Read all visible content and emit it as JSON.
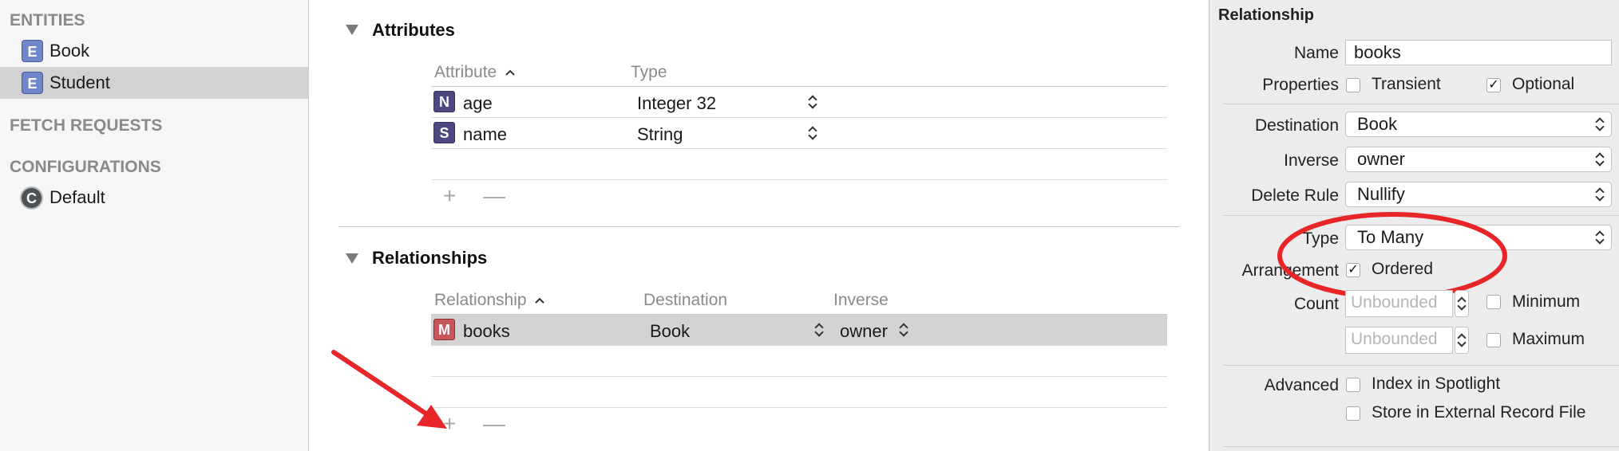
{
  "sidebar": {
    "entities_header": "ENTITIES",
    "entities": [
      {
        "badge": "E",
        "label": "Book",
        "selected": false
      },
      {
        "badge": "E",
        "label": "Student",
        "selected": true
      }
    ],
    "fetch_requests_header": "FETCH REQUESTS",
    "configurations_header": "CONFIGURATIONS",
    "configurations": [
      {
        "badge": "C",
        "label": "Default"
      }
    ]
  },
  "attributes": {
    "title": "Attributes",
    "columns": [
      "Attribute",
      "Type"
    ],
    "rows": [
      {
        "badge": "N",
        "name": "age",
        "type": "Integer 32"
      },
      {
        "badge": "S",
        "name": "name",
        "type": "String"
      }
    ],
    "add_label": "+",
    "remove_label": "—"
  },
  "relationships": {
    "title": "Relationships",
    "columns": [
      "Relationship",
      "Destination",
      "Inverse"
    ],
    "rows": [
      {
        "badge": "M",
        "name": "books",
        "destination": "Book",
        "inverse": "owner",
        "selected": true
      }
    ],
    "add_label": "+",
    "remove_label": "—"
  },
  "inspector": {
    "title": "Relationship",
    "name_label": "Name",
    "name_value": "books",
    "properties_label": "Properties",
    "transient_label": "Transient",
    "transient_checked": false,
    "optional_label": "Optional",
    "optional_checked": true,
    "destination_label": "Destination",
    "destination_value": "Book",
    "inverse_label": "Inverse",
    "inverse_value": "owner",
    "delete_rule_label": "Delete Rule",
    "delete_rule_value": "Nullify",
    "type_label": "Type",
    "type_value": "To Many",
    "arrangement_label": "Arrangement",
    "ordered_label": "Ordered",
    "ordered_checked": true,
    "count_label": "Count",
    "min_placeholder": "Unbounded",
    "max_placeholder": "Unbounded",
    "minimum_label": "Minimum",
    "maximum_label": "Maximum",
    "advanced_label": "Advanced",
    "spotlight_label": "Index in Spotlight",
    "external_label": "Store in External Record File"
  },
  "colors": {
    "annotation_red": "#e8262a",
    "selection_gray": "#d3d3d3"
  }
}
